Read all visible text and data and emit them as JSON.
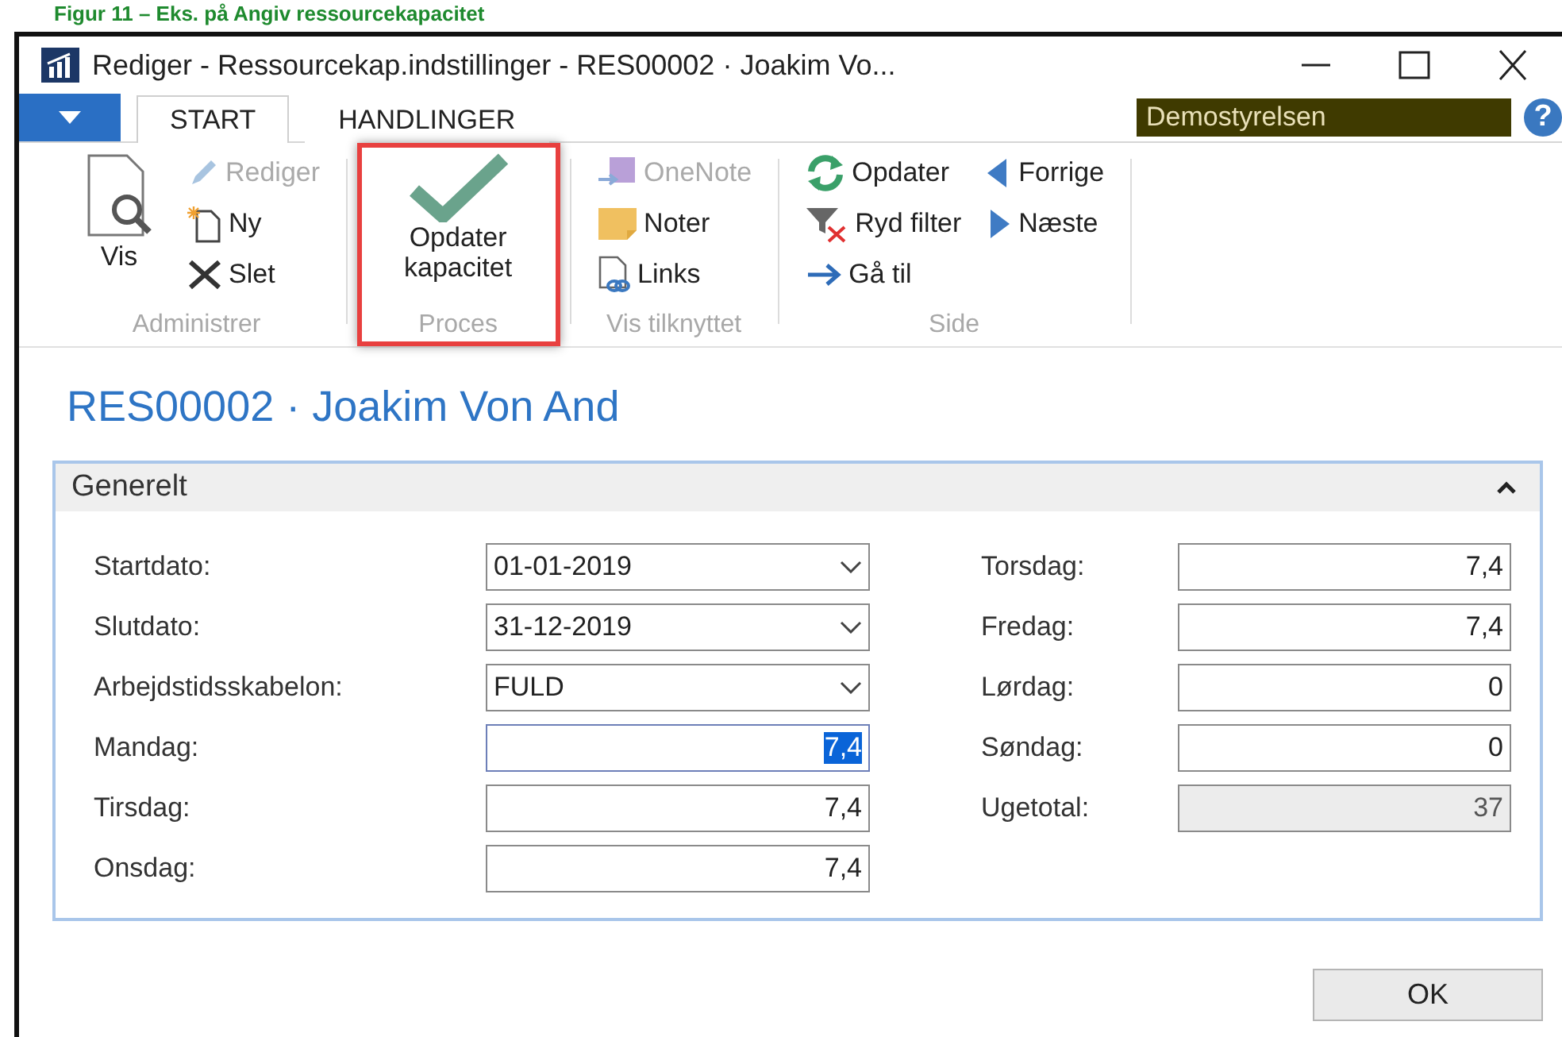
{
  "caption": "Figur 11 – Eks. på Angiv ressourcekapacitet",
  "window": {
    "title": "Rediger - Ressourcekap.indstillinger - RES00002 · Joakim Vo..."
  },
  "tabs": [
    {
      "label": "START",
      "selected": true
    },
    {
      "label": "HANDLINGER",
      "selected": false
    }
  ],
  "company": "Demostyrelsen",
  "help": "?",
  "ribbon": [
    {
      "name": "Administrer",
      "highlighted": false,
      "items": [
        {
          "kind": "large",
          "label": "Vis",
          "disabled": false
        },
        {
          "kind": "small",
          "label": "Rediger",
          "disabled": true
        },
        {
          "kind": "small",
          "label": "Ny",
          "disabled": false
        },
        {
          "kind": "small",
          "label": "Slet",
          "disabled": false
        }
      ]
    },
    {
      "name": "Proces",
      "highlighted": true,
      "items": [
        {
          "kind": "large",
          "label": "Opdater kapacitet",
          "disabled": false
        }
      ]
    },
    {
      "name": "Vis tilknyttet",
      "highlighted": false,
      "items": [
        {
          "kind": "small",
          "label": "OneNote",
          "disabled": true
        },
        {
          "kind": "small",
          "label": "Noter",
          "disabled": false
        },
        {
          "kind": "small",
          "label": "Links",
          "disabled": false
        }
      ]
    },
    {
      "name": "Side",
      "highlighted": false,
      "items": [
        {
          "kind": "small",
          "label": "Opdater",
          "disabled": false
        },
        {
          "kind": "small",
          "label": "Ryd filter",
          "disabled": false
        },
        {
          "kind": "small",
          "label": "Gå til",
          "disabled": false
        },
        {
          "kind": "small",
          "label": "Forrige",
          "disabled": false
        },
        {
          "kind": "small",
          "label": "Næste",
          "disabled": false
        }
      ]
    }
  ],
  "heading": "RES00002 · Joakim Von And",
  "section": {
    "title": "Generelt",
    "expanded": true,
    "left": [
      {
        "label": "Startdato:",
        "value": "01-01-2019",
        "kind": "dropdown",
        "focused": false,
        "readonly": false
      },
      {
        "label": "Slutdato:",
        "value": "31-12-2019",
        "kind": "dropdown",
        "focused": false,
        "readonly": false
      },
      {
        "label": "Arbejdstidsskabelon:",
        "value": "FULD",
        "kind": "dropdown",
        "focused": false,
        "readonly": false
      },
      {
        "label": "Mandag:",
        "value": "7,4",
        "kind": "number",
        "focused": true,
        "readonly": false
      },
      {
        "label": "Tirsdag:",
        "value": "7,4",
        "kind": "number",
        "focused": false,
        "readonly": false
      },
      {
        "label": "Onsdag:",
        "value": "7,4",
        "kind": "number",
        "focused": false,
        "readonly": false
      }
    ],
    "right": [
      {
        "label": "Torsdag:",
        "value": "7,4",
        "kind": "number",
        "focused": false,
        "readonly": false
      },
      {
        "label": "Fredag:",
        "value": "7,4",
        "kind": "number",
        "focused": false,
        "readonly": false
      },
      {
        "label": "Lørdag:",
        "value": "0",
        "kind": "number",
        "focused": false,
        "readonly": false
      },
      {
        "label": "Søndag:",
        "value": "0",
        "kind": "number",
        "focused": false,
        "readonly": false
      },
      {
        "label": "Ugetotal:",
        "value": "37",
        "kind": "number",
        "focused": false,
        "readonly": true
      }
    ]
  },
  "buttons": [
    "OK"
  ]
}
